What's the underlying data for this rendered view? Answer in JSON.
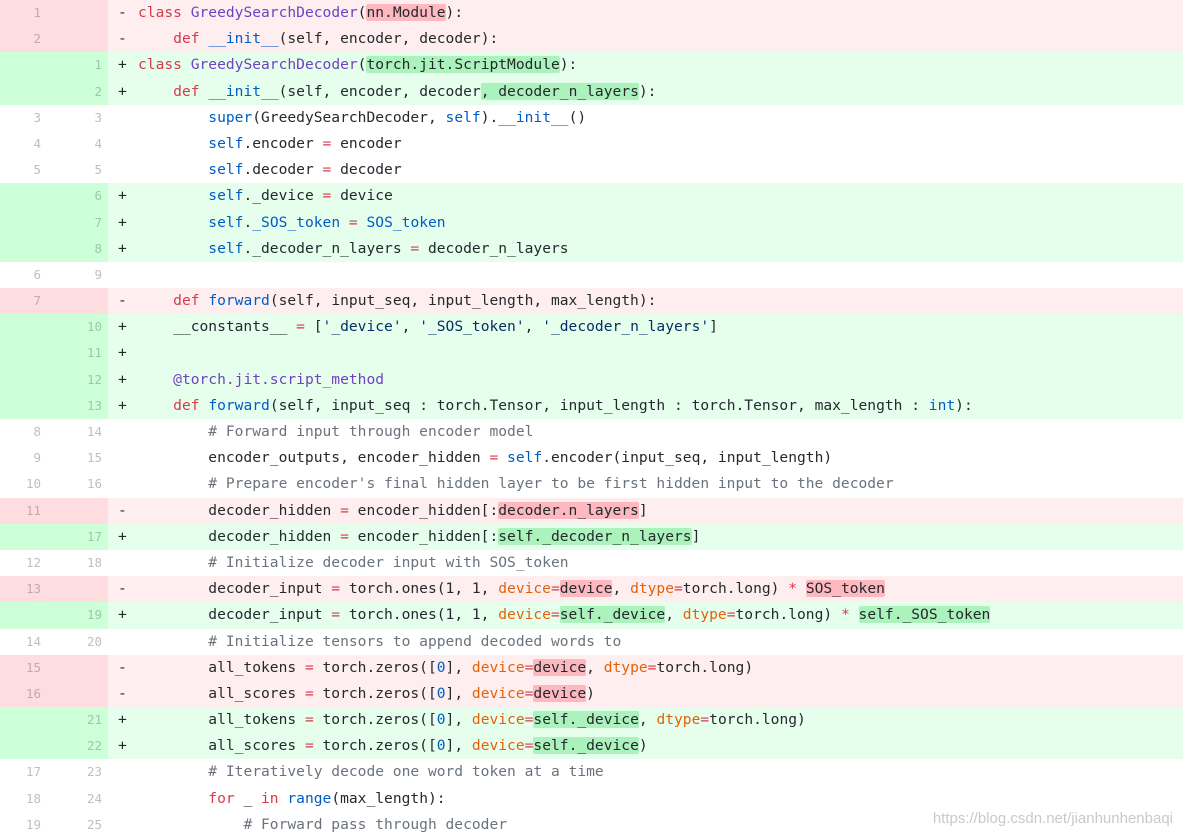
{
  "watermark": "https://blog.csdn.net/jianhunhenbaqi",
  "colors": {
    "deleted_line_bg": "#ffeef0",
    "added_line_bg": "#e6ffed",
    "deleted_highlight": "#fdb8c0",
    "added_highlight": "#acf2bd"
  },
  "lines": [
    {
      "old": "1",
      "new": "",
      "kind": "del",
      "sign": "-",
      "tokens": [
        {
          "t": "class",
          "c": "k"
        },
        {
          "t": " "
        },
        {
          "t": "GreedySearchDecoder",
          "c": "f"
        },
        {
          "t": "("
        },
        {
          "t": "nn.Module",
          "h": 1
        },
        {
          "t": "):"
        }
      ]
    },
    {
      "old": "2",
      "new": "",
      "kind": "del",
      "sign": "-",
      "tokens": [
        {
          "t": "    "
        },
        {
          "t": "def",
          "c": "k"
        },
        {
          "t": " "
        },
        {
          "t": "__init__",
          "c": "b"
        },
        {
          "t": "(self, encoder, decoder):"
        }
      ]
    },
    {
      "old": "",
      "new": "1",
      "kind": "add",
      "sign": "+",
      "tokens": [
        {
          "t": "class",
          "c": "k"
        },
        {
          "t": " "
        },
        {
          "t": "GreedySearchDecoder",
          "c": "f"
        },
        {
          "t": "("
        },
        {
          "t": "torch.jit.ScriptModule",
          "h": 1
        },
        {
          "t": "):"
        }
      ]
    },
    {
      "old": "",
      "new": "2",
      "kind": "add",
      "sign": "+",
      "tokens": [
        {
          "t": "    "
        },
        {
          "t": "def",
          "c": "k"
        },
        {
          "t": " "
        },
        {
          "t": "__init__",
          "c": "b"
        },
        {
          "t": "(self, encoder, decoder"
        },
        {
          "t": ", decoder_n_layers",
          "h": 1
        },
        {
          "t": "):"
        }
      ]
    },
    {
      "old": "3",
      "new": "3",
      "kind": "ctx",
      "sign": "",
      "tokens": [
        {
          "t": "        "
        },
        {
          "t": "super",
          "c": "b"
        },
        {
          "t": "(GreedySearchDecoder, "
        },
        {
          "t": "self",
          "c": "b"
        },
        {
          "t": ")."
        },
        {
          "t": "__init__",
          "c": "b"
        },
        {
          "t": "()"
        }
      ]
    },
    {
      "old": "4",
      "new": "4",
      "kind": "ctx",
      "sign": "",
      "tokens": [
        {
          "t": "        "
        },
        {
          "t": "self",
          "c": "b"
        },
        {
          "t": ".encoder "
        },
        {
          "t": "=",
          "c": "o"
        },
        {
          "t": " encoder"
        }
      ]
    },
    {
      "old": "5",
      "new": "5",
      "kind": "ctx",
      "sign": "",
      "tokens": [
        {
          "t": "        "
        },
        {
          "t": "self",
          "c": "b"
        },
        {
          "t": ".decoder "
        },
        {
          "t": "=",
          "c": "o"
        },
        {
          "t": " decoder"
        }
      ]
    },
    {
      "old": "",
      "new": "6",
      "kind": "add",
      "sign": "+",
      "tokens": [
        {
          "t": "        "
        },
        {
          "t": "self",
          "c": "b"
        },
        {
          "t": "._device "
        },
        {
          "t": "=",
          "c": "o"
        },
        {
          "t": " device"
        }
      ]
    },
    {
      "old": "",
      "new": "7",
      "kind": "add",
      "sign": "+",
      "tokens": [
        {
          "t": "        "
        },
        {
          "t": "self",
          "c": "b"
        },
        {
          "t": "."
        },
        {
          "t": "_SOS_token",
          "c": "b"
        },
        {
          "t": " "
        },
        {
          "t": "=",
          "c": "o"
        },
        {
          "t": " "
        },
        {
          "t": "SOS_token",
          "c": "b"
        }
      ]
    },
    {
      "old": "",
      "new": "8",
      "kind": "add",
      "sign": "+",
      "tokens": [
        {
          "t": "        "
        },
        {
          "t": "self",
          "c": "b"
        },
        {
          "t": "._decoder_n_layers "
        },
        {
          "t": "=",
          "c": "o"
        },
        {
          "t": " decoder_n_layers"
        }
      ]
    },
    {
      "old": "6",
      "new": "9",
      "kind": "ctx",
      "sign": "",
      "tokens": []
    },
    {
      "old": "7",
      "new": "",
      "kind": "del",
      "sign": "-",
      "tokens": [
        {
          "t": "    "
        },
        {
          "t": "def",
          "c": "k"
        },
        {
          "t": " "
        },
        {
          "t": "forward",
          "c": "b"
        },
        {
          "t": "(self, input_seq, input_length, max_length):"
        }
      ]
    },
    {
      "old": "",
      "new": "10",
      "kind": "add",
      "sign": "+",
      "tokens": [
        {
          "t": "    __constants__ "
        },
        {
          "t": "=",
          "c": "o"
        },
        {
          "t": " ["
        },
        {
          "t": "'_device'",
          "c": "s"
        },
        {
          "t": ", "
        },
        {
          "t": "'_SOS_token'",
          "c": "s"
        },
        {
          "t": ", "
        },
        {
          "t": "'_decoder_n_layers'",
          "c": "s"
        },
        {
          "t": "]"
        }
      ]
    },
    {
      "old": "",
      "new": "11",
      "kind": "add",
      "sign": "+",
      "tokens": []
    },
    {
      "old": "",
      "new": "12",
      "kind": "add",
      "sign": "+",
      "tokens": [
        {
          "t": "    "
        },
        {
          "t": "@torch.jit.script_method",
          "c": "d"
        }
      ]
    },
    {
      "old": "",
      "new": "13",
      "kind": "add",
      "sign": "+",
      "tokens": [
        {
          "t": "    "
        },
        {
          "t": "def",
          "c": "k"
        },
        {
          "t": " "
        },
        {
          "t": "forward",
          "c": "b"
        },
        {
          "t": "(self, input_seq : torch.Tensor, input_length : torch.Tensor, max_length : "
        },
        {
          "t": "int",
          "c": "b"
        },
        {
          "t": "):"
        }
      ]
    },
    {
      "old": "8",
      "new": "14",
      "kind": "ctx",
      "sign": "",
      "tokens": [
        {
          "t": "        "
        },
        {
          "t": "# Forward input through encoder model",
          "c": "c"
        }
      ]
    },
    {
      "old": "9",
      "new": "15",
      "kind": "ctx",
      "sign": "",
      "tokens": [
        {
          "t": "        encoder_outputs, encoder_hidden "
        },
        {
          "t": "=",
          "c": "o"
        },
        {
          "t": " "
        },
        {
          "t": "self",
          "c": "b"
        },
        {
          "t": ".encoder(input_seq, input_length)"
        }
      ]
    },
    {
      "old": "10",
      "new": "16",
      "kind": "ctx",
      "sign": "",
      "tokens": [
        {
          "t": "        "
        },
        {
          "t": "# Prepare encoder's final hidden layer to be first hidden input to the decoder",
          "c": "c"
        }
      ]
    },
    {
      "old": "11",
      "new": "",
      "kind": "del",
      "sign": "-",
      "tokens": [
        {
          "t": "        decoder_hidden "
        },
        {
          "t": "=",
          "c": "o"
        },
        {
          "t": " encoder_hidden[:"
        },
        {
          "t": "decoder.n_layers",
          "h": 1
        },
        {
          "t": "]"
        }
      ]
    },
    {
      "old": "",
      "new": "17",
      "kind": "add",
      "sign": "+",
      "tokens": [
        {
          "t": "        decoder_hidden "
        },
        {
          "t": "=",
          "c": "o"
        },
        {
          "t": " encoder_hidden[:"
        },
        {
          "t": "self._decoder_n_layers",
          "h": 1
        },
        {
          "t": "]"
        }
      ]
    },
    {
      "old": "12",
      "new": "18",
      "kind": "ctx",
      "sign": "",
      "tokens": [
        {
          "t": "        "
        },
        {
          "t": "# Initialize decoder input with SOS_token",
          "c": "c"
        }
      ]
    },
    {
      "old": "13",
      "new": "",
      "kind": "del",
      "sign": "-",
      "tokens": [
        {
          "t": "        decoder_input "
        },
        {
          "t": "=",
          "c": "o"
        },
        {
          "t": " torch.ones(1, 1, "
        },
        {
          "t": "device",
          "c": "p"
        },
        {
          "t": "=",
          "c": "o"
        },
        {
          "t": "device",
          "h": 1
        },
        {
          "t": ", "
        },
        {
          "t": "dtype",
          "c": "p"
        },
        {
          "t": "=",
          "c": "o"
        },
        {
          "t": "torch.long) "
        },
        {
          "t": "*",
          "c": "o"
        },
        {
          "t": " "
        },
        {
          "t": "SOS_token",
          "h": 1
        }
      ]
    },
    {
      "old": "",
      "new": "19",
      "kind": "add",
      "sign": "+",
      "tokens": [
        {
          "t": "        decoder_input "
        },
        {
          "t": "=",
          "c": "o"
        },
        {
          "t": " torch.ones(1, 1, "
        },
        {
          "t": "device",
          "c": "p"
        },
        {
          "t": "=",
          "c": "o"
        },
        {
          "t": "self._device",
          "h": 1
        },
        {
          "t": ", "
        },
        {
          "t": "dtype",
          "c": "p"
        },
        {
          "t": "=",
          "c": "o"
        },
        {
          "t": "torch.long) "
        },
        {
          "t": "*",
          "c": "o"
        },
        {
          "t": " "
        },
        {
          "t": "self._SOS_token",
          "h": 1
        }
      ]
    },
    {
      "old": "14",
      "new": "20",
      "kind": "ctx",
      "sign": "",
      "tokens": [
        {
          "t": "        "
        },
        {
          "t": "# Initialize tensors to append decoded words to",
          "c": "c"
        }
      ]
    },
    {
      "old": "15",
      "new": "",
      "kind": "del",
      "sign": "-",
      "tokens": [
        {
          "t": "        all_tokens "
        },
        {
          "t": "=",
          "c": "o"
        },
        {
          "t": " torch.zeros(["
        },
        {
          "t": "0",
          "c": "n"
        },
        {
          "t": "], "
        },
        {
          "t": "device",
          "c": "p"
        },
        {
          "t": "=",
          "c": "o"
        },
        {
          "t": "device",
          "h": 1
        },
        {
          "t": ", "
        },
        {
          "t": "dtype",
          "c": "p"
        },
        {
          "t": "=",
          "c": "o"
        },
        {
          "t": "torch.long)"
        }
      ]
    },
    {
      "old": "16",
      "new": "",
      "kind": "del",
      "sign": "-",
      "tokens": [
        {
          "t": "        all_scores "
        },
        {
          "t": "=",
          "c": "o"
        },
        {
          "t": " torch.zeros(["
        },
        {
          "t": "0",
          "c": "n"
        },
        {
          "t": "], "
        },
        {
          "t": "device",
          "c": "p"
        },
        {
          "t": "=",
          "c": "o"
        },
        {
          "t": "device",
          "h": 1
        },
        {
          "t": ")"
        }
      ]
    },
    {
      "old": "",
      "new": "21",
      "kind": "add",
      "sign": "+",
      "tokens": [
        {
          "t": "        all_tokens "
        },
        {
          "t": "=",
          "c": "o"
        },
        {
          "t": " torch.zeros(["
        },
        {
          "t": "0",
          "c": "n"
        },
        {
          "t": "], "
        },
        {
          "t": "device",
          "c": "p"
        },
        {
          "t": "=",
          "c": "o"
        },
        {
          "t": "self._device",
          "h": 1
        },
        {
          "t": ", "
        },
        {
          "t": "dtype",
          "c": "p"
        },
        {
          "t": "=",
          "c": "o"
        },
        {
          "t": "torch.long)"
        }
      ]
    },
    {
      "old": "",
      "new": "22",
      "kind": "add",
      "sign": "+",
      "tokens": [
        {
          "t": "        all_scores "
        },
        {
          "t": "=",
          "c": "o"
        },
        {
          "t": " torch.zeros(["
        },
        {
          "t": "0",
          "c": "n"
        },
        {
          "t": "], "
        },
        {
          "t": "device",
          "c": "p"
        },
        {
          "t": "=",
          "c": "o"
        },
        {
          "t": "self._device",
          "h": 1
        },
        {
          "t": ")"
        }
      ]
    },
    {
      "old": "17",
      "new": "23",
      "kind": "ctx",
      "sign": "",
      "tokens": [
        {
          "t": "        "
        },
        {
          "t": "# Iteratively decode one word token at a time",
          "c": "c"
        }
      ]
    },
    {
      "old": "18",
      "new": "24",
      "kind": "ctx",
      "sign": "",
      "tokens": [
        {
          "t": "        "
        },
        {
          "t": "for",
          "c": "k"
        },
        {
          "t": " _ "
        },
        {
          "t": "in",
          "c": "k"
        },
        {
          "t": " "
        },
        {
          "t": "range",
          "c": "b"
        },
        {
          "t": "(max_length):"
        }
      ]
    },
    {
      "old": "19",
      "new": "25",
      "kind": "ctx",
      "sign": "",
      "tokens": [
        {
          "t": "            "
        },
        {
          "t": "# Forward pass through decoder",
          "c": "c"
        }
      ]
    }
  ]
}
